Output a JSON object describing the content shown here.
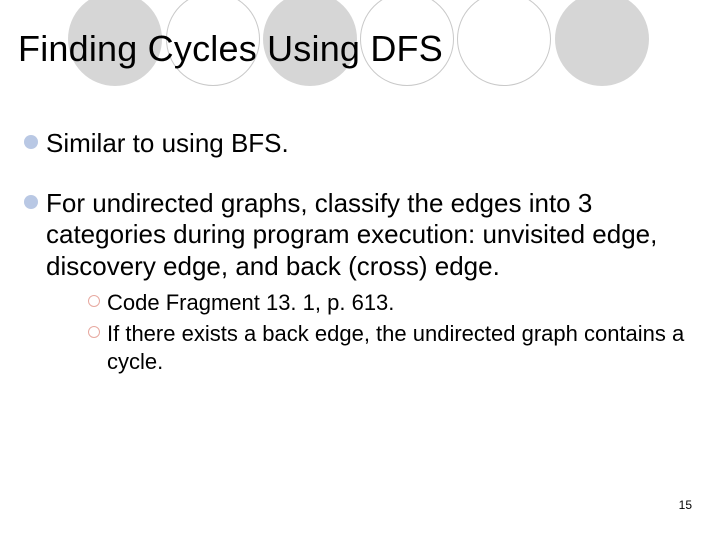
{
  "title": "Finding Cycles Using DFS",
  "bullets": [
    {
      "text": "Similar to using BFS."
    },
    {
      "text": "For undirected graphs, classify the edges into 3 categories during program execution: unvisited edge, discovery edge, and back (cross) edge.",
      "sub": [
        {
          "text": "Code Fragment 13. 1, p. 613."
        },
        {
          "text": "If there exists a back edge, the undirected graph contains a cycle."
        }
      ]
    }
  ],
  "page_number": "15",
  "theme": {
    "filled_circle_color": "#d6d6d6",
    "ring_color": "#c9c9c9",
    "lvl1_bullet_color": "#b9c8e4",
    "lvl2_ring_color": "#e7a9a0"
  }
}
